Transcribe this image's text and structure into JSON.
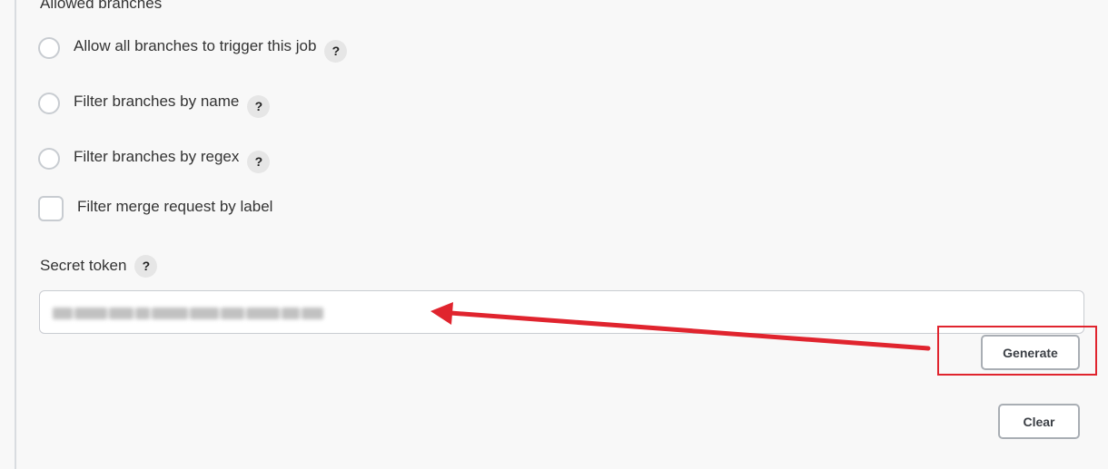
{
  "section": {
    "heading": "Allowed branches"
  },
  "options": [
    {
      "label": "Allow all branches to trigger this job",
      "help": "?"
    },
    {
      "label": "Filter branches by name",
      "help": "?"
    },
    {
      "label": "Filter branches by regex",
      "help": "?"
    },
    {
      "label": "Filter merge request by label"
    }
  ],
  "token": {
    "label": "Secret token",
    "help": "?"
  },
  "buttons": {
    "generate": "Generate",
    "clear": "Clear"
  },
  "colors": {
    "annotation": "#e0242e",
    "button_border": "#a9aeb4",
    "input_border": "#c9ccd1"
  }
}
